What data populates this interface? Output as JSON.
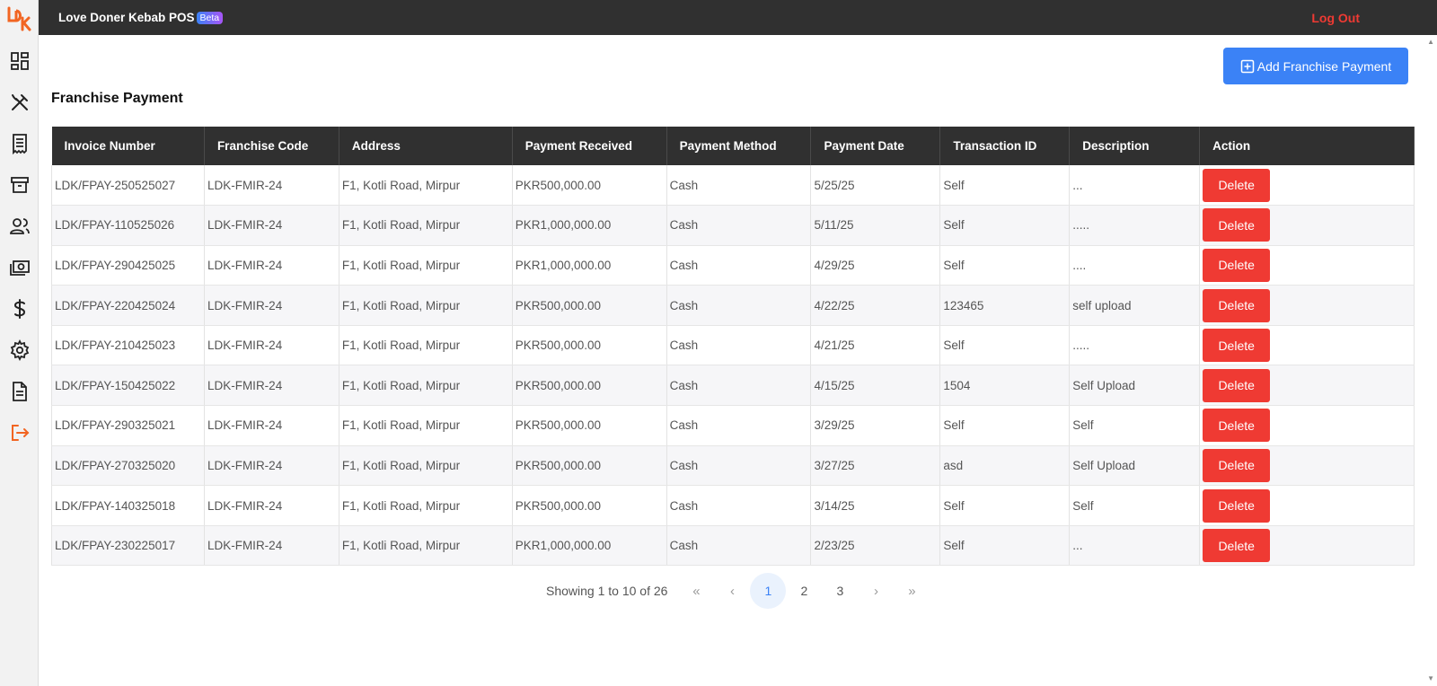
{
  "header": {
    "app_title": "Love Doner Kebab POS",
    "beta_badge": "Beta",
    "logout_label": "Log Out"
  },
  "sidebar": {
    "logo_text": "LDK",
    "icons": [
      "dashboard-icon",
      "utensils-icon",
      "receipt-icon",
      "archive-icon",
      "users-icon",
      "cash-icon",
      "dollar-icon",
      "gear-icon",
      "document-icon",
      "logout-icon"
    ]
  },
  "main": {
    "add_button_label": "Add Franchise Payment",
    "page_title": "Franchise Payment",
    "table": {
      "columns": [
        "Invoice Number",
        "Franchise Code",
        "Address",
        "Payment Received",
        "Payment Method",
        "Payment Date",
        "Transaction ID",
        "Description",
        "Action"
      ],
      "rows": [
        [
          "LDK/FPAY-250525027",
          "LDK-FMIR-24",
          "F1, Kotli Road, Mirpur",
          "PKR500,000.00",
          "Cash",
          "5/25/25",
          "Self",
          "..."
        ],
        [
          "LDK/FPAY-110525026",
          "LDK-FMIR-24",
          "F1, Kotli Road, Mirpur",
          "PKR1,000,000.00",
          "Cash",
          "5/11/25",
          "Self",
          "....."
        ],
        [
          "LDK/FPAY-290425025",
          "LDK-FMIR-24",
          "F1, Kotli Road, Mirpur",
          "PKR1,000,000.00",
          "Cash",
          "4/29/25",
          "Self",
          "...."
        ],
        [
          "LDK/FPAY-220425024",
          "LDK-FMIR-24",
          "F1, Kotli Road, Mirpur",
          "PKR500,000.00",
          "Cash",
          "4/22/25",
          "123465",
          "self upload"
        ],
        [
          "LDK/FPAY-210425023",
          "LDK-FMIR-24",
          "F1, Kotli Road, Mirpur",
          "PKR500,000.00",
          "Cash",
          "4/21/25",
          "Self",
          "....."
        ],
        [
          "LDK/FPAY-150425022",
          "LDK-FMIR-24",
          "F1, Kotli Road, Mirpur",
          "PKR500,000.00",
          "Cash",
          "4/15/25",
          "1504",
          "Self Upload"
        ],
        [
          "LDK/FPAY-290325021",
          "LDK-FMIR-24",
          "F1, Kotli Road, Mirpur",
          "PKR500,000.00",
          "Cash",
          "3/29/25",
          "Self",
          "Self"
        ],
        [
          "LDK/FPAY-270325020",
          "LDK-FMIR-24",
          "F1, Kotli Road, Mirpur",
          "PKR500,000.00",
          "Cash",
          "3/27/25",
          "asd",
          "Self Upload"
        ],
        [
          "LDK/FPAY-140325018",
          "LDK-FMIR-24",
          "F1, Kotli Road, Mirpur",
          "PKR500,000.00",
          "Cash",
          "3/14/25",
          "Self",
          "Self"
        ],
        [
          "LDK/FPAY-230225017",
          "LDK-FMIR-24",
          "F1, Kotli Road, Mirpur",
          "PKR1,000,000.00",
          "Cash",
          "2/23/25",
          "Self",
          "..."
        ]
      ],
      "delete_label": "Delete"
    },
    "pagination": {
      "info": "Showing 1 to 10 of 26",
      "first": "«",
      "prev": "‹",
      "pages": [
        "1",
        "2",
        "3"
      ],
      "active_page": "1",
      "next": "›",
      "last": "»"
    }
  },
  "colors": {
    "topbar": "#303030",
    "accent_blue": "#3b82f6",
    "danger_red": "#ef3a33",
    "logo_orange": "#f26522"
  }
}
